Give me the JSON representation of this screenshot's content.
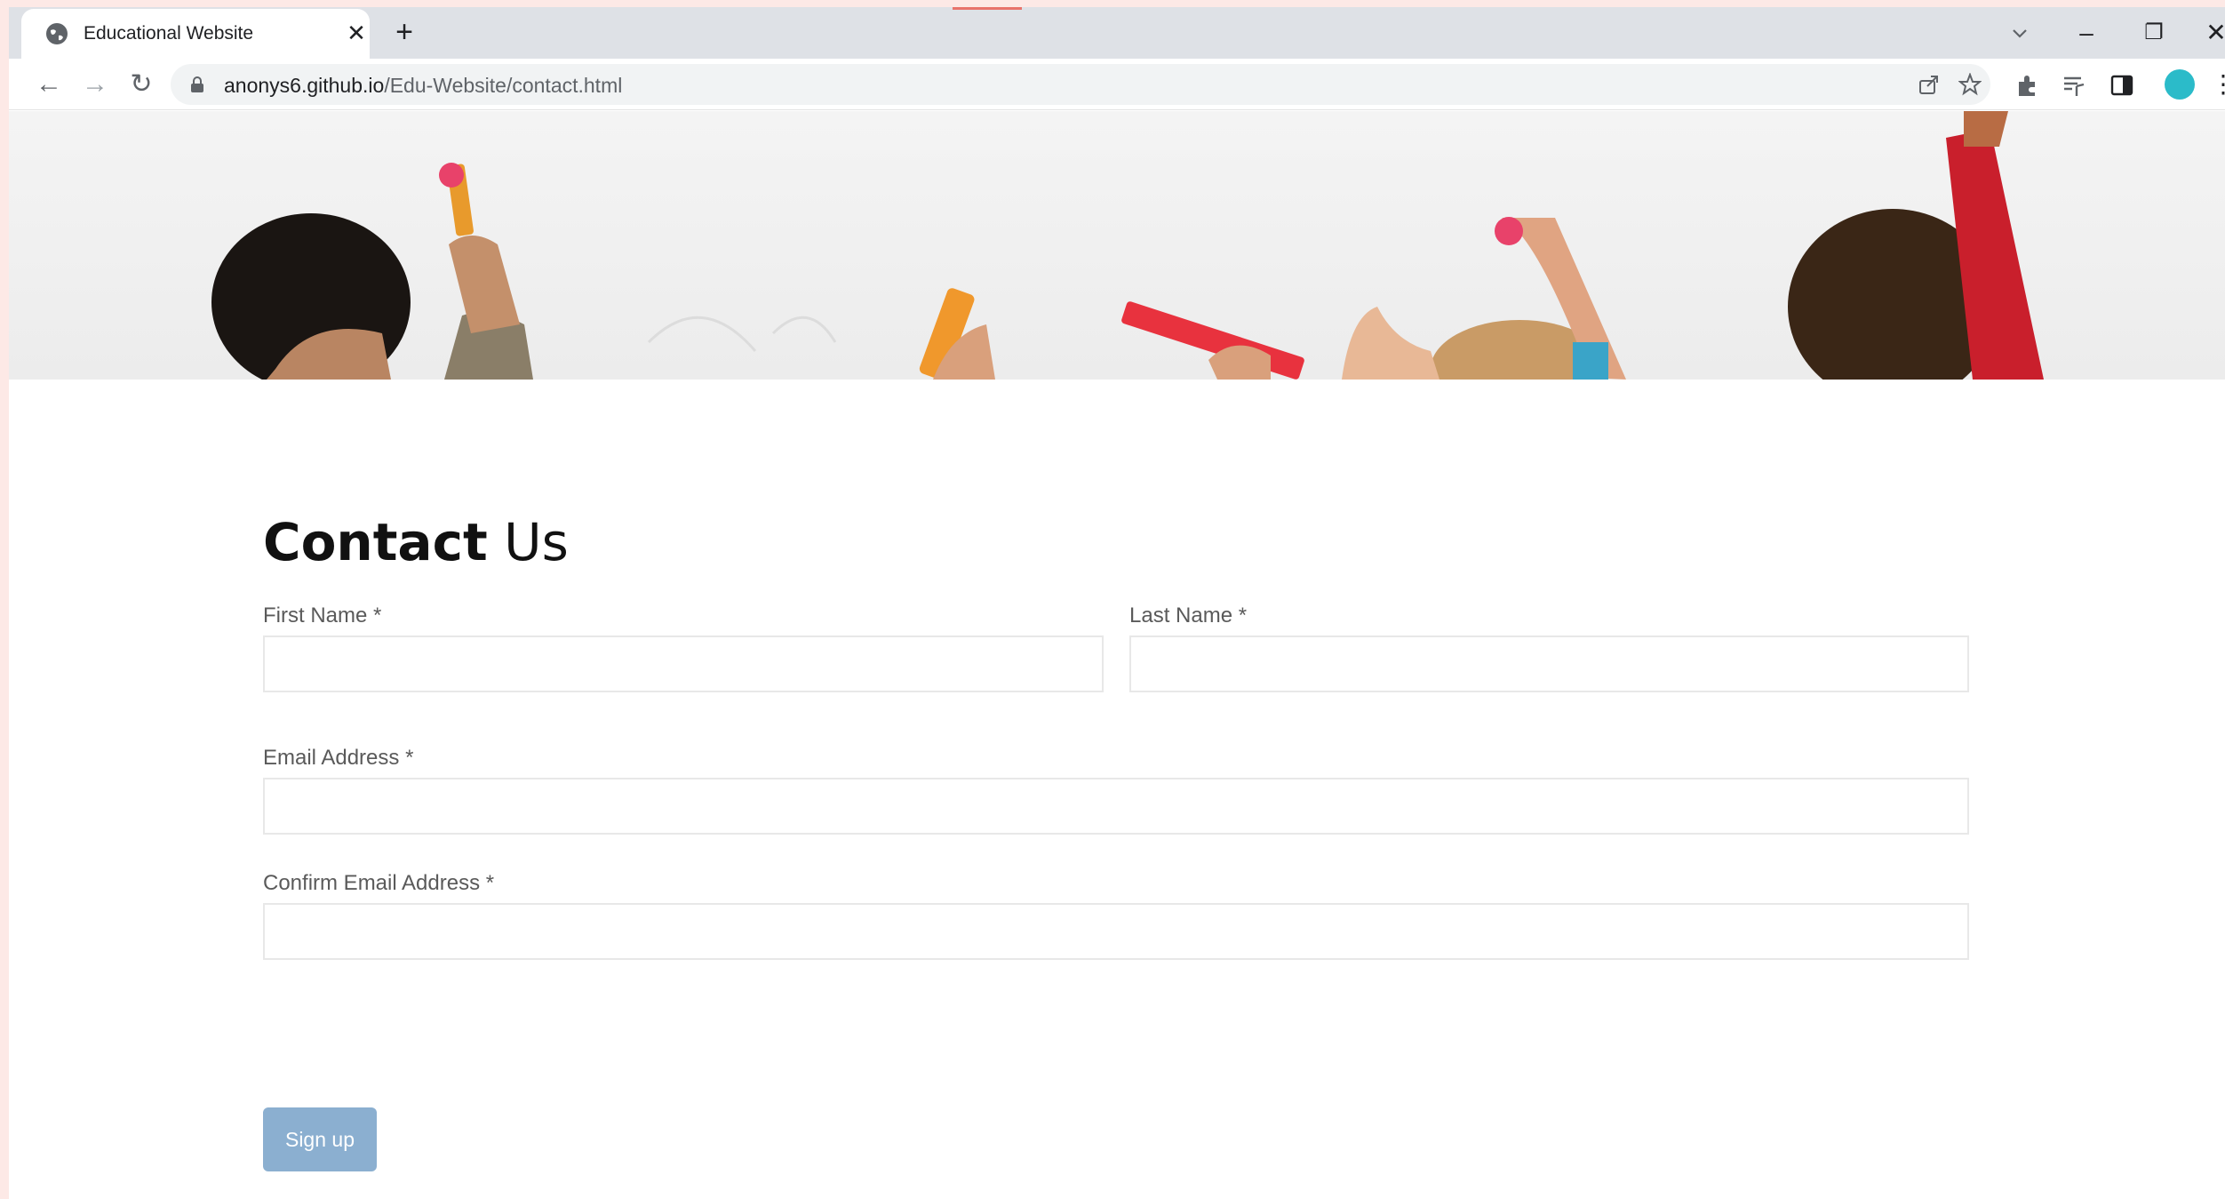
{
  "browser": {
    "tab_title": "Educational Website",
    "tab_close": "✕",
    "new_tab": "+",
    "url_host": "anonys6.github.io",
    "url_path": "/Edu-Website/contact.html",
    "window_controls": {
      "minimize": "–",
      "restore": "❐",
      "close": "✕"
    },
    "nav": {
      "back": "←",
      "forward": "→",
      "reload": "↻"
    },
    "menu": "⋮"
  },
  "contact": {
    "title_bold": "Contact",
    "title_light": " Us",
    "first_name_label": "First Name *",
    "last_name_label": "Last Name *",
    "email_label": "Email Address *",
    "confirm_email_label": "Confirm Email Address *",
    "first_name_value": "",
    "last_name_value": "",
    "email_value": "",
    "confirm_email_value": "",
    "submit_label": "Sign up"
  },
  "colors": {
    "button": "#8bafd0",
    "tabstrip": "#dee1e6",
    "avatar": "#2bbbc9"
  }
}
